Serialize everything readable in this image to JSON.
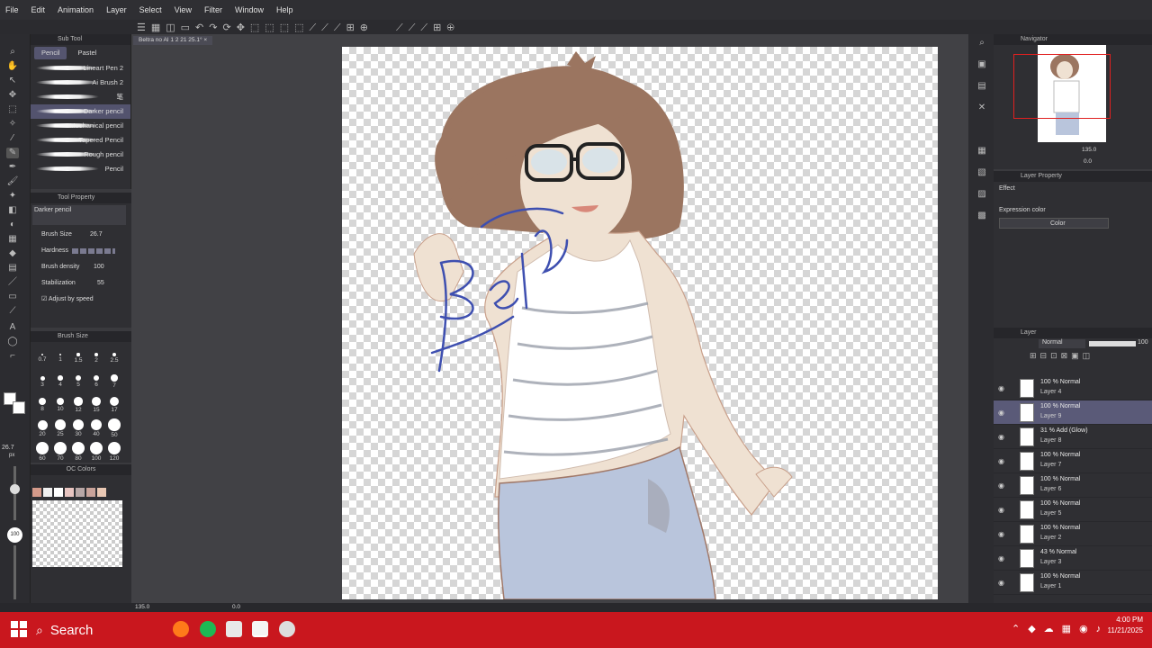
{
  "menu": [
    "File",
    "Edit",
    "Animation",
    "Layer",
    "Select",
    "View",
    "Filter",
    "Window",
    "Help"
  ],
  "document_tab": "Beltra no AI 1 2 21   25.1° ×",
  "subtool": {
    "title": "Sub Tool",
    "tabs": [
      "Pencil",
      "Pastel"
    ],
    "brushes": [
      "Lineart Pen 2",
      "Ai Brush 2",
      "笔",
      "Darker pencil",
      "Mechanical pencil",
      "Tapered Pencil",
      "Rough pencil",
      "Pencil"
    ],
    "selected_index": 3
  },
  "tool_property": {
    "title": "Tool Property",
    "preset": "Darker pencil",
    "brush_size_label": "Brush Size",
    "brush_size_value": "26.7",
    "hardness_label": "Hardness",
    "brush_density_label": "Brush density",
    "brush_density_value": "100",
    "stabilization_label": "Stabilization",
    "stabilization_value": "55",
    "adjust_speed_label": "Adjust by speed"
  },
  "brush_size_panel": {
    "title": "Brush Size",
    "sizes": [
      "0.7",
      "1",
      "1.5",
      "2",
      "2.5",
      "3",
      "4",
      "5",
      "6",
      "7",
      "8",
      "10",
      "12",
      "15",
      "17",
      "20",
      "25",
      "30",
      "40",
      "50",
      "60",
      "70",
      "80",
      "100",
      "120"
    ]
  },
  "left_readouts": {
    "size": "26.7",
    "unit": "px",
    "opacity": "100"
  },
  "colors_panel": {
    "title": "OC Colors",
    "swatches": [
      "#d49a8a",
      "#f0f0f0",
      "#ffffff",
      "#e7c4c0",
      "#b8a7a6",
      "#c9a39a",
      "#e9c8b4"
    ]
  },
  "navigator": {
    "title": "Navigator",
    "zoom": "135.0",
    "rotation": "0.0"
  },
  "layer_property": {
    "title": "Layer Property",
    "effect_label": "Effect",
    "expression_color_label": "Expression color",
    "expression_value": "Color"
  },
  "layers_panel": {
    "title": "Layer",
    "blend_mode": "Normal",
    "opacity": "100",
    "items": [
      {
        "mode": "100 % Normal",
        "name": "Layer 4"
      },
      {
        "mode": "100 % Normal",
        "name": "Layer 9"
      },
      {
        "mode": "31 % Add (Glow)",
        "name": "Layer 8"
      },
      {
        "mode": "100 % Normal",
        "name": "Layer 7"
      },
      {
        "mode": "100 % Normal",
        "name": "Layer 6"
      },
      {
        "mode": "100 % Normal",
        "name": "Layer 5"
      },
      {
        "mode": "100 % Normal",
        "name": "Layer 2"
      },
      {
        "mode": "43 % Normal",
        "name": "Layer 3"
      },
      {
        "mode": "100 % Normal",
        "name": "Layer 1"
      }
    ],
    "selected_index": 1
  },
  "status": {
    "zoom": "135.0",
    "angle": "0.0"
  },
  "taskbar": {
    "search_label": "Search",
    "time": "4:00 PM",
    "date": "11/21/2025"
  },
  "colors": {
    "taskbar": "#c9171e",
    "selection": "#5a5a78",
    "canvas_sketch": "#3e4fb0"
  }
}
